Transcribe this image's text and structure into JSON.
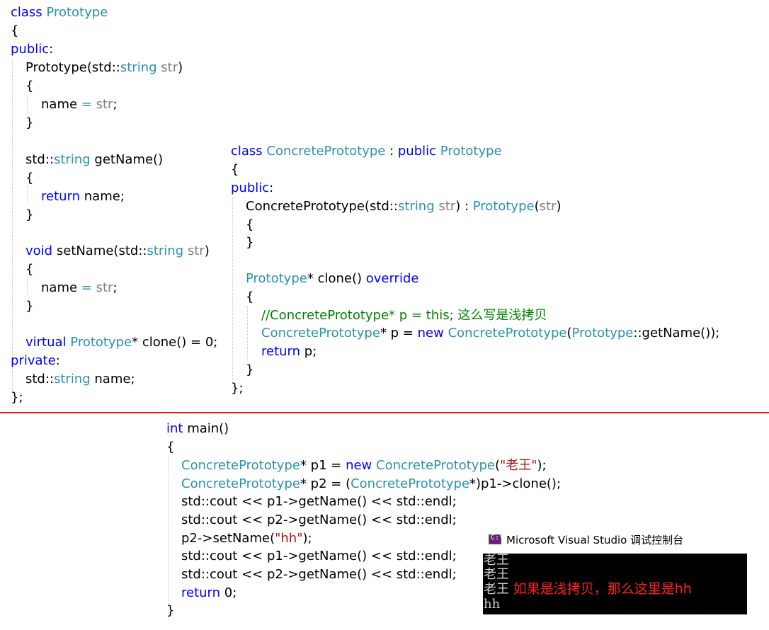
{
  "prototype_class": {
    "l1_kw": "class",
    "l1_name": "Prototype",
    "l2": "{",
    "l3_kw": "public",
    "l3_colon": ":",
    "l4_a": "Prototype(std::",
    "l4_ty": "string",
    "l4_sp": " ",
    "l4_pm": "str",
    "l4_b": ")",
    "l5": "{",
    "l6_a": "name ",
    "l6_eq": "=",
    "l6_sp": " ",
    "l6_pm": "str",
    "l6_b": ";",
    "l7": "}",
    "l9_a": "std::",
    "l9_ty": "string",
    "l9_b": " getName()",
    "l10": "{",
    "l11_kw": "return",
    "l11_b": " name;",
    "l12": "}",
    "l14_kw": "void",
    "l14_a": " setName(std::",
    "l14_ty": "string",
    "l14_sp": " ",
    "l14_pm": "str",
    "l14_b": ")",
    "l15": "{",
    "l16_a": "name ",
    "l16_eq": "=",
    "l16_sp": " ",
    "l16_pm": "str",
    "l16_b": ";",
    "l17": "}",
    "l19_kw": "virtual",
    "l19_sp": " ",
    "l19_ty": "Prototype",
    "l19_b": "* clone() = 0;",
    "l20_kw": "private",
    "l20_colon": ":",
    "l21_a": "std::",
    "l21_ty": "string",
    "l21_b": " name;",
    "l22": "};"
  },
  "concrete_class": {
    "l1_kw": "class",
    "l1_ty": "ConcretePrototype",
    "l1_a": " : ",
    "l1_kw2": "public",
    "l1_sp": " ",
    "l1_ty2": "Prototype",
    "l2": "{",
    "l3_kw": "public",
    "l3_colon": ":",
    "l4_a": "ConcretePrototype(std::",
    "l4_ty": "string",
    "l4_sp": " ",
    "l4_pm": "str",
    "l4_b": ") : ",
    "l4_ty2": "Prototype",
    "l4_c": "(",
    "l4_pm2": "str",
    "l4_d": ")",
    "l5": "{",
    "l6": "}",
    "l8_ty": "Prototype",
    "l8_a": "* clone() ",
    "l8_kw": "override",
    "l9": "{",
    "l10_cm": "//ConcretePrototype* p = this; 这么写是浅拷贝",
    "l11_ty": "ConcretePrototype",
    "l11_a": "* p = ",
    "l11_kw": "new",
    "l11_sp": " ",
    "l11_ty2": "ConcretePrototype",
    "l11_b": "(",
    "l11_ty3": "Prototype",
    "l11_c": "::getName());",
    "l12_kw": "return",
    "l12_a": " p;",
    "l13": "}",
    "l14": "};"
  },
  "main_func": {
    "l1_kw": "int",
    "l1_a": " main()",
    "l2": "{",
    "l3_ty": "ConcretePrototype",
    "l3_a": "* p1 = ",
    "l3_kw": "new",
    "l3_sp": " ",
    "l3_ty2": "ConcretePrototype",
    "l3_b": "(",
    "l3_st": "\"老王\"",
    "l3_c": ");",
    "l4_ty": "ConcretePrototype",
    "l4_a": "* p2 = (",
    "l4_ty2": "ConcretePrototype",
    "l4_b": "*)p1->clone();",
    "l5": "std::cout << p1->getName() << std::endl;",
    "l6": "std::cout << p2->getName() << std::endl;",
    "l7_a": "p2->setName(",
    "l7_st": "\"hh\"",
    "l7_b": ");",
    "l8": "std::cout << p1->getName() << std::endl;",
    "l9": "std::cout << p2->getName() << std::endl;",
    "l10_kw": "return",
    "l10_a": " 0;",
    "l11": "}"
  },
  "console": {
    "title": "Microsoft Visual Studio 调试控制台",
    "icon_glyph": "C:\\",
    "lines": [
      "老王",
      "老王",
      "老王",
      "hh"
    ],
    "note": "如果是浅拷贝，那么这里是hh"
  },
  "colors": {
    "keyword": "#0000ff",
    "type": "#2b91af",
    "param": "#808080",
    "string": "#a31515",
    "comment": "#008000",
    "divider": "#e02020",
    "note": "#ff2020"
  }
}
